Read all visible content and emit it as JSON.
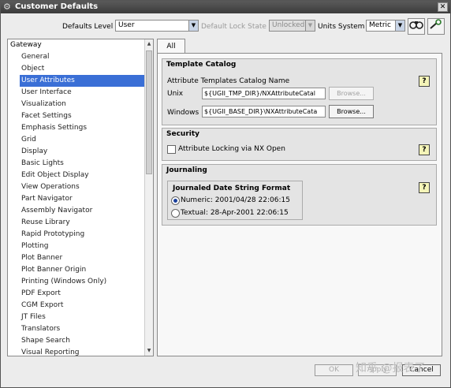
{
  "window": {
    "title": "Customer Defaults"
  },
  "header": {
    "defaults_level_label": "Defaults Level",
    "defaults_level_value": "User",
    "default_lock_state_label": "Default Lock State",
    "default_lock_state_value": "Unlocked",
    "units_system_label": "Units System",
    "units_system_value": "Metric"
  },
  "tree": {
    "root": "Gateway",
    "items": [
      "General",
      "Object",
      "User Attributes",
      "User Interface",
      "Visualization",
      "Facet Settings",
      "Emphasis Settings",
      "Grid",
      "Display",
      "Basic Lights",
      "Edit Object Display",
      "View Operations",
      "Part Navigator",
      "Assembly Navigator",
      "Reuse Library",
      "Rapid Prototyping",
      "Plotting",
      "Plot Banner",
      "Plot Banner Origin",
      "Printing (Windows Only)",
      "PDF Export",
      "CGM Export",
      "JT Files",
      "Translators",
      "Shape Search",
      "Visual Reporting"
    ],
    "selected": "User Attributes"
  },
  "tabs": [
    {
      "label": "All"
    }
  ],
  "template_catalog": {
    "title": "Template Catalog",
    "catalog_name_label": "Attribute Templates Catalog Name",
    "unix_label": "Unix",
    "unix_value": "${UGII_TMP_DIR}/NXAttributeCatal",
    "windows_label": "Windows",
    "windows_value": "${UGII_BASE_DIR}\\NXAttributeCata",
    "browse_label": "Browse..."
  },
  "security": {
    "title": "Security",
    "attribute_locking_label": "Attribute Locking via NX Open",
    "attribute_locking_checked": false
  },
  "journaling": {
    "title": "Journaling",
    "group_title": "Journaled Date String Format",
    "numeric_option": "Numeric: 2001/04/28 22:06:15",
    "textual_option": "Textual: 28-Apr-2001 22:06:15",
    "selected": "numeric"
  },
  "help_symbol": "?",
  "footer": {
    "ok_label": "OK",
    "apply_label": "Apply",
    "cancel_label": "Cancel"
  },
  "watermark": "知乎 @报表了",
  "colors": {
    "selection": "#3a6fd6",
    "title_bar": "#4a4a4a"
  }
}
